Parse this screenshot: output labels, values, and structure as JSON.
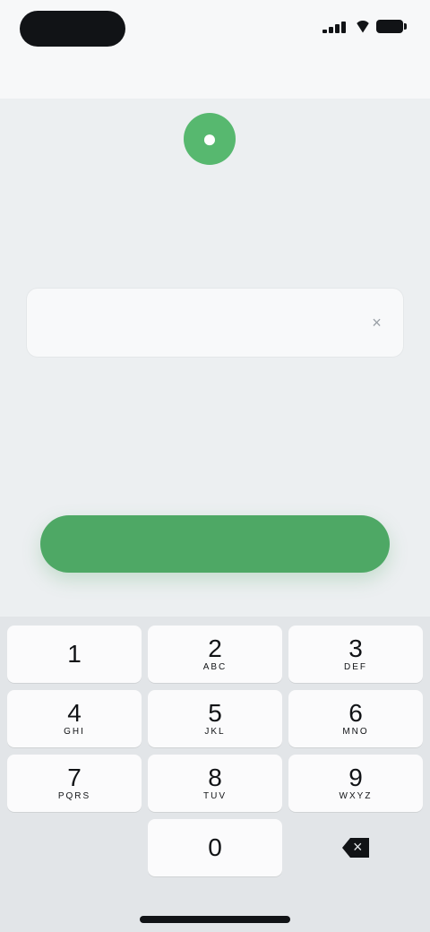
{
  "status_bar": {
    "time": "",
    "signal_icon": "signal-icon",
    "wifi_icon": "wifi-icon",
    "battery_icon": "battery-icon"
  },
  "header": {
    "title": ""
  },
  "brand": {
    "logo_icon": "brand-logo-icon",
    "name": ""
  },
  "intro": {
    "line1": "",
    "accent": "",
    "line2": ""
  },
  "phone_field": {
    "country_code": "",
    "placeholder": "",
    "value": "",
    "clear_icon": "clear-icon"
  },
  "notice": {
    "text": "",
    "prefix": "",
    "link": ""
  },
  "actions": {
    "primary_label": ""
  },
  "keyboard": {
    "rows": [
      [
        {
          "num": "1",
          "letters": ""
        },
        {
          "num": "2",
          "letters": "ABC"
        },
        {
          "num": "3",
          "letters": "DEF"
        }
      ],
      [
        {
          "num": "4",
          "letters": "GHI"
        },
        {
          "num": "5",
          "letters": "JKL"
        },
        {
          "num": "6",
          "letters": "MNO"
        }
      ],
      [
        {
          "num": "7",
          "letters": "PQRS"
        },
        {
          "num": "8",
          "letters": "TUV"
        },
        {
          "num": "9",
          "letters": "WXYZ"
        }
      ],
      [
        {
          "num": "",
          "letters": ""
        },
        {
          "num": "0",
          "letters": ""
        },
        {
          "num": "",
          "letters": ""
        }
      ]
    ],
    "delete_icon": "delete-icon"
  },
  "colors": {
    "accent": "#4ea865",
    "background": "#eceff1"
  }
}
